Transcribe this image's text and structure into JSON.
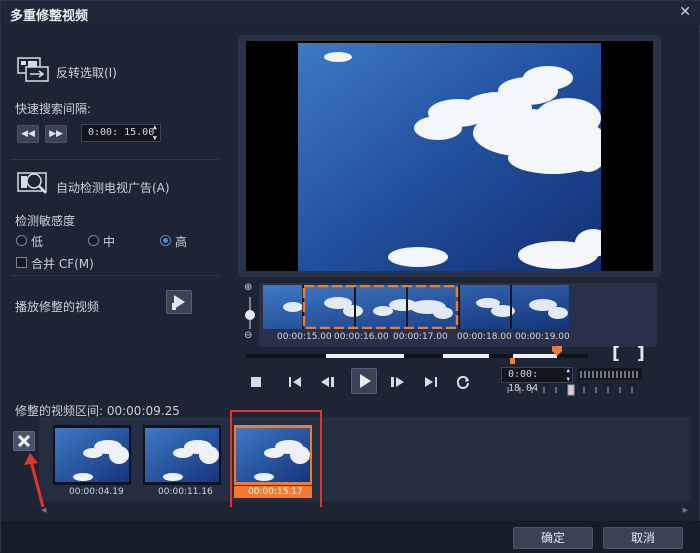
{
  "window": {
    "title": "多重修整视频"
  },
  "left_panel": {
    "invert_selection": "反转选取(I)",
    "quick_search_label": "快速搜索间隔:",
    "quick_search_time": "0:00: 15.00",
    "auto_detect_ads": "自动检测电视广告(A)",
    "sensitivity_label": "检测敏感度",
    "sensitivity_options": [
      "低",
      "中",
      "高"
    ],
    "sensitivity_selected": "高",
    "merge_cf": "合并 CF(M)",
    "play_trimmed": "播放修整的视频"
  },
  "timeline": {
    "thumb_timestamps": [
      "00:00:15.00",
      "00:00:16.00",
      "00:00:17.00",
      "00:00:18.00",
      "00:00:19.00"
    ],
    "current_time": "0:00: 18.04",
    "bracket_in": "[",
    "bracket_out": "]"
  },
  "trimmed": {
    "label": "修整的视频区间: 00:00:09.25",
    "clips": [
      {
        "time": "00:00:04.19"
      },
      {
        "time": "00:00:11.16"
      },
      {
        "time": "00:00:15.17",
        "selected": true
      }
    ]
  },
  "buttons": {
    "ok": "确定",
    "cancel": "取消"
  },
  "colors": {
    "accent": "#f07a30",
    "annotation_red": "#e3342f",
    "radio_on": "#3a8ff0"
  }
}
